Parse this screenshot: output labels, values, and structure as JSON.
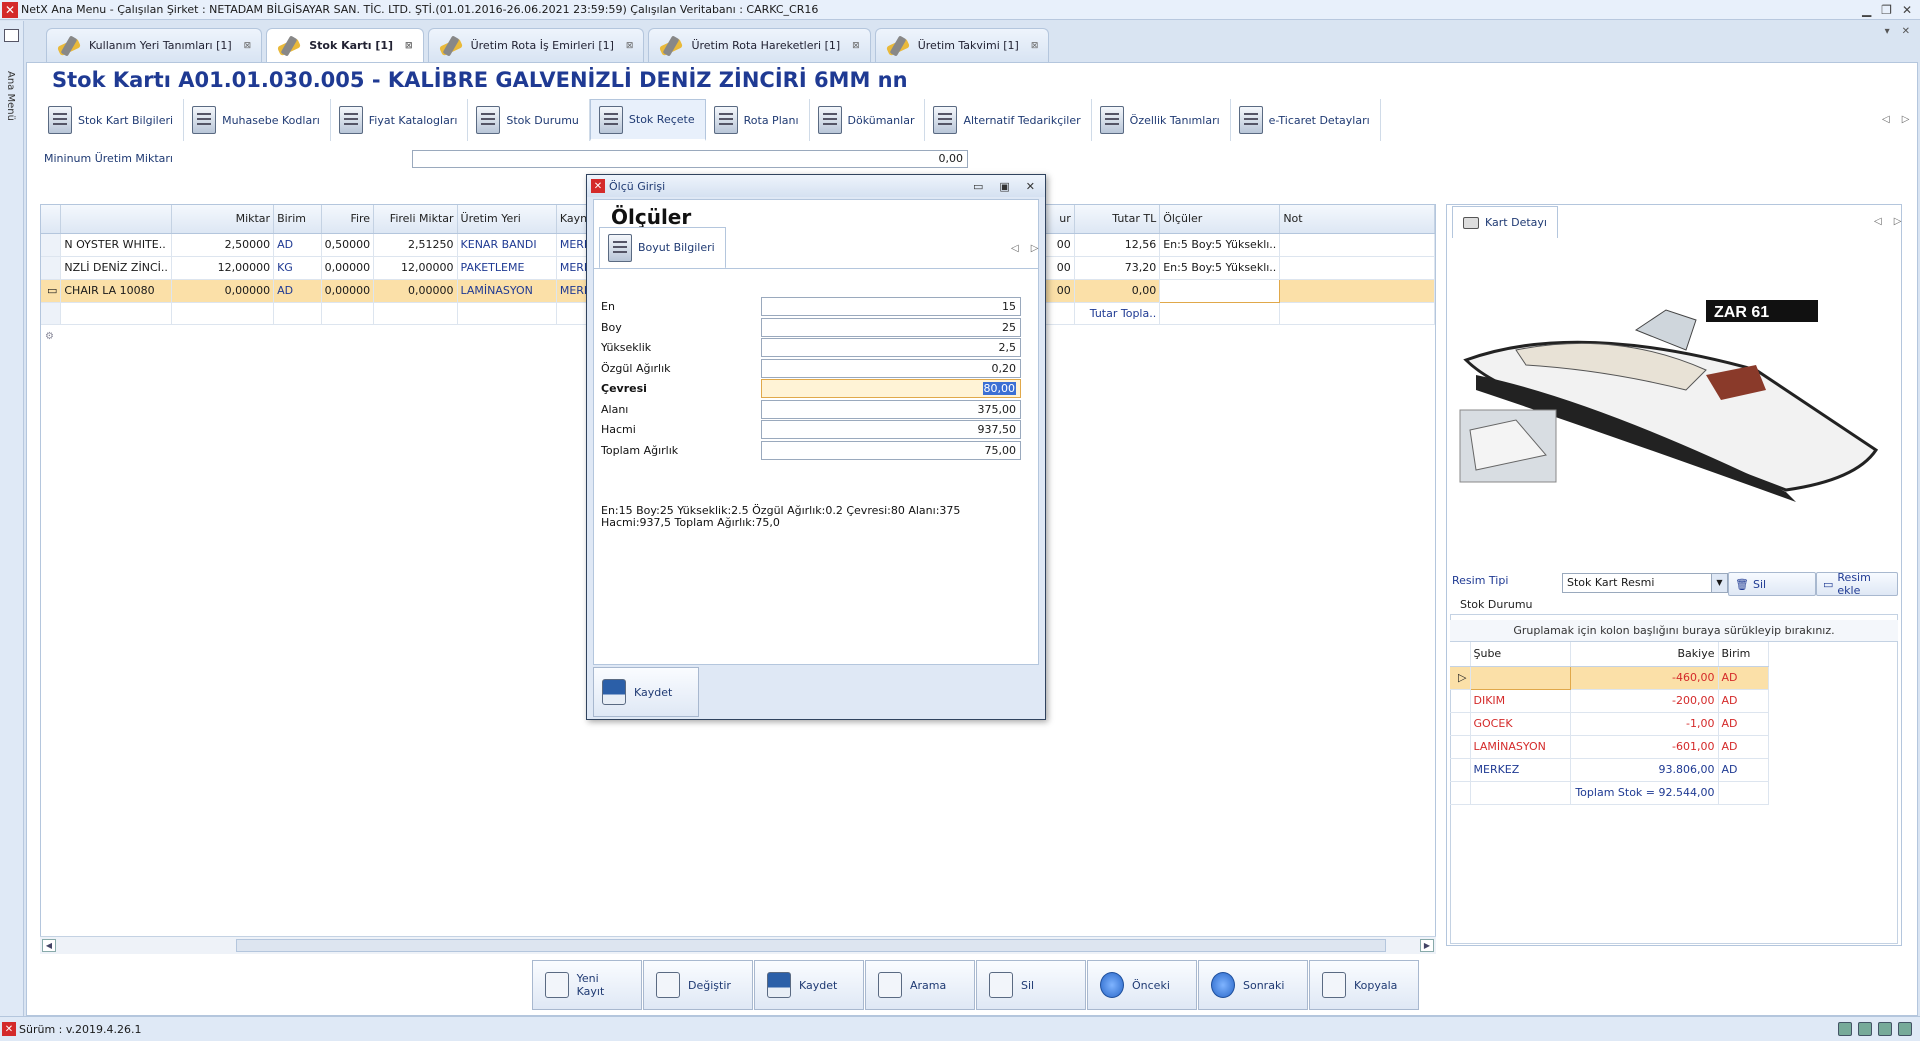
{
  "window": {
    "title": "NetX Ana Menu - Çalışılan Şirket : NETADAM BİLGİSAYAR SAN. TİC. LTD. ŞTİ.(01.01.2016-26.06.2021 23:59:59) Çalışılan Veritabanı : CARKC_CR16"
  },
  "left_rail": {
    "label": "Ana Menü"
  },
  "doc_tabs": [
    {
      "label": "Kullanım Yeri Tanımları [1]"
    },
    {
      "label": "Stok Kartı [1]"
    },
    {
      "label": "Üretim Rota İş Emirleri [1]"
    },
    {
      "label": "Üretim Rota Hareketleri [1]"
    },
    {
      "label": "Üretim Takvimi [1]"
    }
  ],
  "page_title": "Stok Kartı  A01.01.030.005 - KALİBRE GALVENİZLİ DENİZ ZİNCİRİ  6MM nn",
  "sub_tabs": [
    {
      "label": "Stok Kart Bilgileri"
    },
    {
      "label": "Muhasebe Kodları"
    },
    {
      "label": "Fiyat Katalogları"
    },
    {
      "label": "Stok Durumu"
    },
    {
      "label": "Stok Reçete"
    },
    {
      "label": "Rota Planı"
    },
    {
      "label": "Dökümanlar"
    },
    {
      "label": "Alternatif Tedarikçiler"
    },
    {
      "label": "Özellik Tanımları"
    },
    {
      "label": "e-Ticaret Detayları"
    }
  ],
  "min_uretim": {
    "label": "Mininum Üretim Miktarı",
    "value": "0,00"
  },
  "grid": {
    "headers": {
      "ad": "",
      "miktar": "Miktar",
      "birim": "Birim",
      "fire": "Fire",
      "fireli": "Fireli Miktar",
      "uretim_yeri": "Üretim Yeri",
      "kaynak": "Kayna",
      "ur": "ur",
      "tutar": "Tutar TL",
      "olculer": "Ölçüler",
      "not": "Not"
    },
    "rows": [
      {
        "ad": "N OYSTER WHITE..",
        "miktar": "2,50000",
        "birim": "AD",
        "fire": "0,50000",
        "fireli": "2,51250",
        "uretim_yeri": "KENAR BANDI",
        "kaynak": "MERK",
        "ur": "00",
        "tutar": "12,56",
        "olculer": "En:5 Boy:5 Yükseklı..",
        "not": ""
      },
      {
        "ad": "NZLİ DENİZ ZİNCİ..",
        "miktar": "12,00000",
        "birim": "KG",
        "fire": "0,00000",
        "fireli": "12,00000",
        "uretim_yeri": "PAKETLEME",
        "kaynak": "MERK",
        "ur": "00",
        "tutar": "73,20",
        "olculer": "En:5 Boy:5 Yükseklı..",
        "not": ""
      },
      {
        "ad": "CHAIR  LA 10080",
        "miktar": "0,00000",
        "birim": "AD",
        "fire": "0,00000",
        "fireli": "0,00000",
        "uretim_yeri": "LAMİNASYON",
        "kaynak": "MERK",
        "ur": "00",
        "tutar": "0,00",
        "olculer": "",
        "not": ""
      }
    ],
    "footer": {
      "tutar_label": "Tutar Topla.."
    }
  },
  "right_panel": {
    "tab_label": "Kart Detayı",
    "boat_brand": "ZAR 61",
    "resim_tipi_label": "Resim Tipi",
    "resim_tipi_value": "Stok Kart Resmi",
    "sil_label": "Sil",
    "resim_ekle_label": "Resim ekle",
    "stok_durumu_label": "Stok Durumu",
    "group_hint": "Gruplamak için kolon başlığını buraya sürükleyip bırakınız.",
    "headers": {
      "sube": "Şube",
      "bakiye": "Bakiye",
      "birim": "Birim"
    },
    "rows": [
      {
        "sube": "",
        "bakiye": "-460,00",
        "birim": "AD"
      },
      {
        "sube": "DIKIM",
        "bakiye": "-200,00",
        "birim": "AD"
      },
      {
        "sube": "GOCEK",
        "bakiye": "-1,00",
        "birim": "AD"
      },
      {
        "sube": "LAMİNASYON",
        "bakiye": "-601,00",
        "birim": "AD"
      },
      {
        "sube": "MERKEZ",
        "bakiye": "93.806,00",
        "birim": "AD"
      }
    ],
    "total": "Toplam Stok = 92.544,00"
  },
  "toolbar": {
    "yeni": "Yeni Kayıt",
    "degistir": "Değiştir",
    "kaydet": "Kaydet",
    "arama": "Arama",
    "sil": "Sil",
    "onceki": "Önceki",
    "sonraki": "Sonraki",
    "kopyala": "Kopyala"
  },
  "status": {
    "version": "Sürüm : v.2019.4.26.1"
  },
  "dialog": {
    "title": "Ölçü Girişi",
    "heading": "Ölçüler",
    "tab_label": "Boyut Bilgileri",
    "fields": [
      {
        "label": "En",
        "value": "15"
      },
      {
        "label": "Boy",
        "value": "25"
      },
      {
        "label": "Yükseklik",
        "value": "2,5"
      },
      {
        "label": "Özgül Ağırlık",
        "value": "0,20"
      },
      {
        "label": "Çevresi",
        "value": "80,00"
      },
      {
        "label": "Alanı",
        "value": "375,00"
      },
      {
        "label": "Hacmi",
        "value": "937,50"
      },
      {
        "label": "Toplam Ağırlık",
        "value": "75,00"
      }
    ],
    "summary": "En:15 Boy:25 Yükseklik:2.5 Özgül Ağırlık:0.2 Çevresi:80 Alanı:375 Hacmi:937,5 Toplam Ağırlık:75,0",
    "save_label": "Kaydet"
  }
}
